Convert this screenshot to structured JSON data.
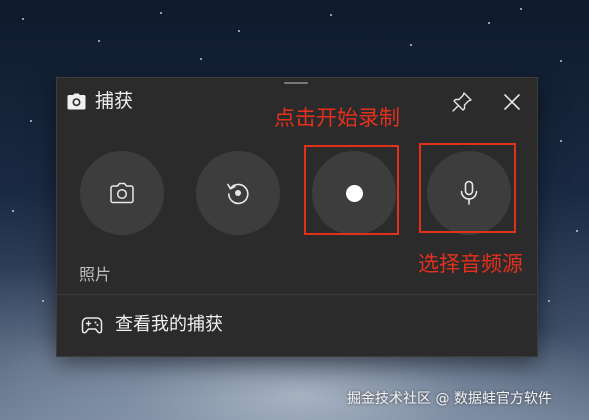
{
  "window": {
    "title": "捕获",
    "title_icon": "camera-icon",
    "pin_icon": "pin-icon",
    "close_icon": "close-icon"
  },
  "capture_buttons": [
    {
      "name": "screenshot",
      "icon": "camera-icon"
    },
    {
      "name": "record-last",
      "icon": "replay-icon"
    },
    {
      "name": "start-recording",
      "icon": "record-dot-icon"
    },
    {
      "name": "microphone",
      "icon": "microphone-icon"
    }
  ],
  "mode_label": "照片",
  "gallery": {
    "label": "查看我的捕获",
    "icon": "gamepad-icon"
  },
  "annotations": {
    "record": "点击开始录制",
    "mic": "选择音频源",
    "color": "#e4301c"
  },
  "watermark": "掘金技术社区 @ 数据蛙官方软件",
  "colors": {
    "panel": "#2b2b2b",
    "button": "#3d3d3d",
    "highlight": "#e0311d"
  }
}
